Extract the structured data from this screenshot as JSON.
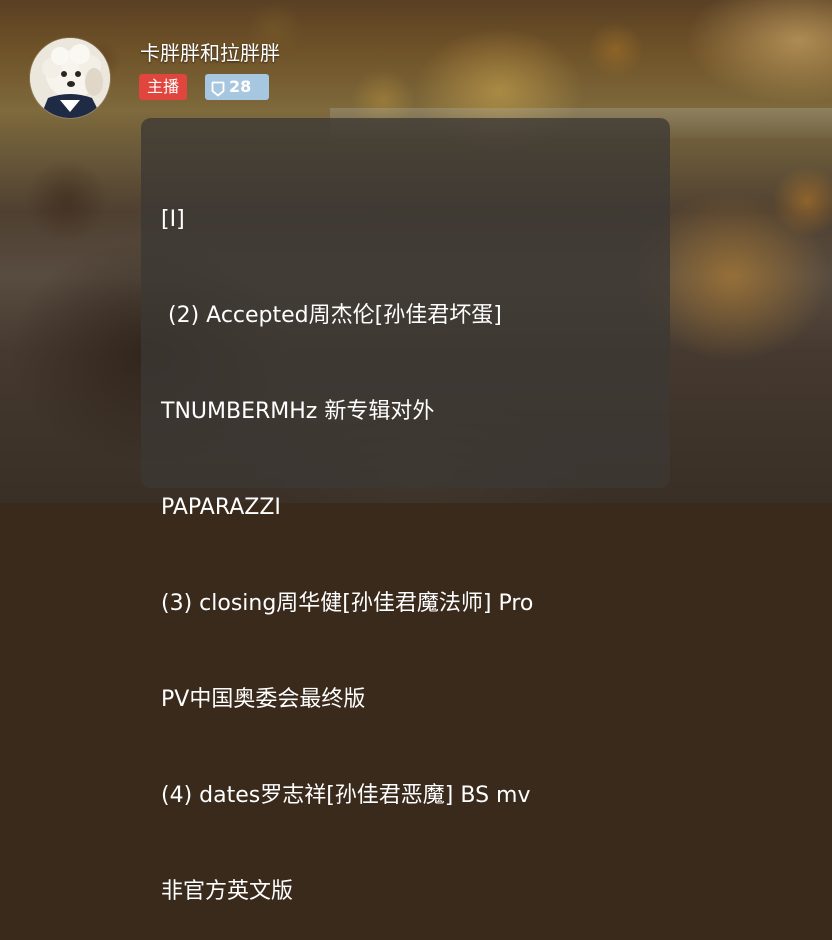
{
  "user": {
    "name": "卡胖胖和拉胖胖",
    "role_badge": "主播",
    "level": "28"
  },
  "message": {
    "lines": [
      "[I]",
      " (2) Accepted周杰伦[孙佳君坏蛋]",
      "TNUMBERMHz 新专辑对外",
      "PAPARAZZI",
      "(3) closing周华健[孙佳君魔法师] Pro",
      "PV中国奥委会最终版",
      "(4) dates罗志祥[孙佳君恶魔] BS mv",
      "非官方英文版"
    ]
  },
  "colors": {
    "role_badge_bg": "#e0453e",
    "level_badge_bg": "#a6c7df",
    "card_bg": "rgba(60,56,52,0.78)",
    "text": "#ffffff"
  },
  "icons": {
    "level_badge": "shield-icon",
    "avatar": "dog-avatar"
  }
}
